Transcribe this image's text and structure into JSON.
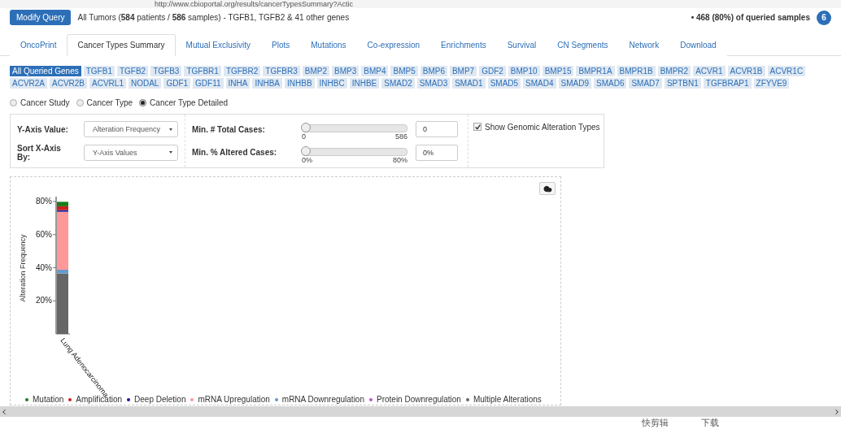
{
  "browser": {
    "url": "http://www.cbioportal.org/results/cancerTypesSummary?Actic"
  },
  "header": {
    "button": "Modify Query",
    "summary": "All Tumors (**584** patients / **586** samples)  - TGFB1, TGFB2 & 41 other genes",
    "queried": "• 468 (80%) of queried samples",
    "badge": "6"
  },
  "tabs": [
    {
      "label": "OncoPrint",
      "selected": false
    },
    {
      "label": "Cancer Types Summary",
      "selected": true
    },
    {
      "label": "Mutual Exclusivity",
      "selected": false
    },
    {
      "label": "Plots",
      "selected": false
    },
    {
      "label": "Mutations",
      "selected": false
    },
    {
      "label": "Co-expression",
      "selected": false
    },
    {
      "label": "Enrichments",
      "selected": false
    },
    {
      "label": "Survival",
      "selected": false
    },
    {
      "label": "CN Segments",
      "selected": false
    },
    {
      "label": "Network",
      "selected": false
    },
    {
      "label": "Download",
      "selected": false
    }
  ],
  "genes": [
    {
      "label": "All Queried Genes",
      "selected": true
    },
    {
      "label": "TGFB1",
      "selected": false
    },
    {
      "label": "TGFB2",
      "selected": false
    },
    {
      "label": "TGFB3",
      "selected": false
    },
    {
      "label": "TGFBR1",
      "selected": false
    },
    {
      "label": "TGFBR2",
      "selected": false
    },
    {
      "label": "TGFBR3",
      "selected": false
    },
    {
      "label": "BMP2",
      "selected": false
    },
    {
      "label": "BMP3",
      "selected": false
    },
    {
      "label": "BMP4",
      "selected": false
    },
    {
      "label": "BMP5",
      "selected": false
    },
    {
      "label": "BMP6",
      "selected": false
    },
    {
      "label": "BMP7",
      "selected": false
    },
    {
      "label": "GDF2",
      "selected": false
    },
    {
      "label": "BMP10",
      "selected": false
    },
    {
      "label": "BMP15",
      "selected": false
    },
    {
      "label": "BMPR1A",
      "selected": false
    },
    {
      "label": "BMPR1B",
      "selected": false
    },
    {
      "label": "BMPR2",
      "selected": false
    },
    {
      "label": "ACVR1",
      "selected": false
    },
    {
      "label": "ACVR1B",
      "selected": false
    },
    {
      "label": "ACVR1C",
      "selected": false
    },
    {
      "label": "ACVR2A",
      "selected": false
    },
    {
      "label": "ACVR2B",
      "selected": false
    },
    {
      "label": "ACVRL1",
      "selected": false
    },
    {
      "label": "NODAL",
      "selected": false
    },
    {
      "label": "GDF1",
      "selected": false
    },
    {
      "label": "GDF11",
      "selected": false
    },
    {
      "label": "INHA",
      "selected": false
    },
    {
      "label": "INHBA",
      "selected": false
    },
    {
      "label": "INHBB",
      "selected": false
    },
    {
      "label": "INHBC",
      "selected": false
    },
    {
      "label": "INHBE",
      "selected": false
    },
    {
      "label": "SMAD2",
      "selected": false
    },
    {
      "label": "SMAD3",
      "selected": false
    },
    {
      "label": "SMAD1",
      "selected": false
    },
    {
      "label": "SMAD5",
      "selected": false
    },
    {
      "label": "SMAD4",
      "selected": false
    },
    {
      "label": "SMAD9",
      "selected": false
    },
    {
      "label": "SMAD6",
      "selected": false
    },
    {
      "label": "SMAD7",
      "selected": false
    },
    {
      "label": "SPTBN1",
      "selected": false
    },
    {
      "label": "TGFBRAP1",
      "selected": false
    },
    {
      "label": "ZFYVE9",
      "selected": false
    }
  ],
  "grouping": [
    {
      "label": "Cancer Study",
      "selected": false
    },
    {
      "label": "Cancer Type",
      "selected": false
    },
    {
      "label": "Cancer Type Detailed",
      "selected": true
    }
  ],
  "options": {
    "y_axis_label": "Y-Axis Value:",
    "y_axis_value": "Alteration Frequency",
    "sort_label": "Sort X-Axis By:",
    "sort_value": "Y-Axis Values",
    "sliders": [
      {
        "label": "Min. # Total Cases:",
        "level": 0,
        "min": "0",
        "max": "586",
        "value": "0"
      },
      {
        "label": "Min. % Altered Cases:",
        "level": 0,
        "min": "0%",
        "max": "80%",
        "value": "0%"
      }
    ],
    "show_types": {
      "label": "Show Genomic Alteration Types",
      "checked": true
    }
  },
  "chart": {
    "chart_data": {
      "type": "bar",
      "ylabel": "Alteration Frequency",
      "categories": [
        "Lung Adenocarcinoma"
      ],
      "stacked": true,
      "ylim": [
        0,
        80
      ],
      "yticks": [
        {
          "value": 20,
          "label": "20%"
        },
        {
          "value": 40,
          "label": "40%"
        },
        {
          "value": 60,
          "label": "60%"
        },
        {
          "value": 80,
          "label": "80%"
        }
      ],
      "series": [
        {
          "name": "Multiple Alterations",
          "color": "#666666",
          "values": [
            36.5
          ]
        },
        {
          "name": "Protein Downregulation",
          "color": "#ba55d3",
          "values": [
            0
          ]
        },
        {
          "name": "mRNA Downregulation",
          "color": "#6699cc",
          "values": [
            2.3
          ]
        },
        {
          "name": "mRNA Upregulation",
          "color": "#ff9999",
          "values": [
            35
          ]
        },
        {
          "name": "Deep Deletion",
          "color": "#1a1a9e",
          "values": [
            1
          ]
        },
        {
          "name": "Amplification",
          "color": "#cc1f1f",
          "values": [
            2.3
          ]
        },
        {
          "name": "Mutation",
          "color": "#1a7d1a",
          "values": [
            2.7
          ]
        }
      ]
    }
  },
  "taskbar": {
    "items": [
      "快剪辑",
      "下载"
    ]
  }
}
